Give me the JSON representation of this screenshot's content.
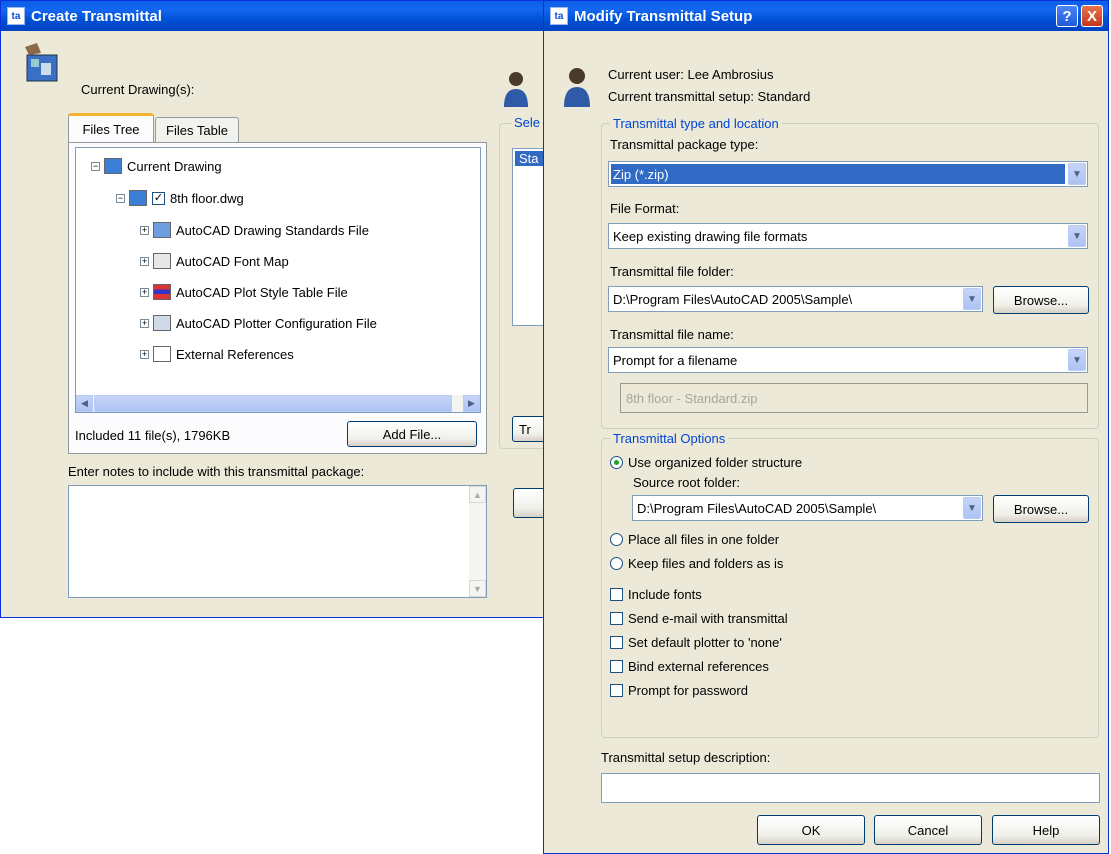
{
  "left_window": {
    "title": "Create Transmittal",
    "current_drawings_label": "Current Drawing(s):",
    "tabs": [
      "Files Tree",
      "Files Table"
    ],
    "tree": [
      {
        "label": "Current Drawing",
        "level": 0,
        "expand": "-"
      },
      {
        "label": "8th floor.dwg",
        "level": 1,
        "expand": "-",
        "checked": true
      },
      {
        "label": "AutoCAD Drawing Standards File",
        "level": 2,
        "expand": "+"
      },
      {
        "label": "AutoCAD Font Map",
        "level": 2,
        "expand": "+"
      },
      {
        "label": "AutoCAD Plot Style Table File",
        "level": 2,
        "expand": "+"
      },
      {
        "label": "AutoCAD Plotter Configuration File",
        "level": 2,
        "expand": "+"
      },
      {
        "label": "External References",
        "level": 2,
        "expand": "+"
      }
    ],
    "status_text": "Included 11 file(s), 1796KB",
    "add_file_button": "Add File...",
    "notes_label": "Enter notes to include with this transmittal package:",
    "partial_labels": {
      "select": "Sele",
      "list_item": "Sta",
      "button": "Tr"
    }
  },
  "right_window": {
    "title": "Modify Transmittal Setup",
    "help_button": "?",
    "close_button": "X",
    "current_user": "Current user: Lee Ambrosius",
    "current_setup": "Current transmittal setup: Standard",
    "group_type_location": "Transmittal type and location",
    "package_type_label": "Transmittal package type:",
    "package_type_value": "Zip (*.zip)",
    "file_format_label": "File Format:",
    "file_format_value": "Keep existing drawing file formats",
    "file_folder_label": "Transmittal file folder:",
    "file_folder_value": "D:\\Program Files\\AutoCAD 2005\\Sample\\",
    "browse_button": "Browse...",
    "file_name_label": "Transmittal file name:",
    "file_name_value": "Prompt for a filename",
    "file_name_preview": "8th floor - Standard.zip",
    "group_options": "Transmittal Options",
    "radio_organized": "Use organized folder structure",
    "source_root_label": "Source root folder:",
    "source_root_value": "D:\\Program Files\\AutoCAD 2005\\Sample\\",
    "browse2_button": "Browse...",
    "radio_one_folder": "Place all files in one folder",
    "radio_keep": "Keep files and folders as is",
    "checkboxes": [
      "Include fonts",
      "Send e-mail with transmittal",
      "Set default plotter to 'none'",
      "Bind external references",
      "Prompt for password"
    ],
    "description_label": "Transmittal setup description:",
    "description_value": "",
    "ok_button": "OK",
    "cancel_button": "Cancel",
    "help_button_bottom": "Help"
  }
}
